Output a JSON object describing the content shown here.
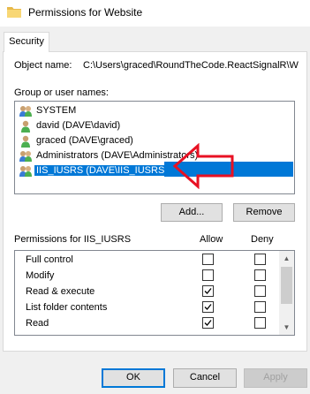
{
  "window": {
    "title": "Permissions for Website"
  },
  "tabs": [
    {
      "label": "Security"
    }
  ],
  "object": {
    "label": "Object name:",
    "value": "C:\\Users\\graced\\RoundTheCode.ReactSignalR\\W"
  },
  "group": {
    "label": "Group or user names:",
    "items": [
      {
        "label": "SYSTEM",
        "icon": "group-users-icon"
      },
      {
        "label": "david (DAVE\\david)",
        "icon": "user-icon"
      },
      {
        "label": "graced (DAVE\\graced)",
        "icon": "user-icon"
      },
      {
        "label": "Administrators (DAVE\\Administrators)",
        "icon": "group-users-icon"
      },
      {
        "label": "IIS_IUSRS (DAVE\\IIS_IUSRS)",
        "icon": "group-users-icon",
        "selected": true
      }
    ]
  },
  "buttons": {
    "add": "Add...",
    "remove": "Remove",
    "ok": "OK",
    "cancel": "Cancel",
    "apply": "Apply"
  },
  "permissions": {
    "label": "Permissions for IIS_IUSRS",
    "allow_header": "Allow",
    "deny_header": "Deny",
    "rows": [
      {
        "name": "Full control",
        "allow": false,
        "deny": false
      },
      {
        "name": "Modify",
        "allow": false,
        "deny": false
      },
      {
        "name": "Read & execute",
        "allow": true,
        "deny": false
      },
      {
        "name": "List folder contents",
        "allow": true,
        "deny": false
      },
      {
        "name": "Read",
        "allow": true,
        "deny": false
      }
    ]
  },
  "colors": {
    "selection": "#0078d7",
    "annotation_arrow": "#e81123",
    "folder": "#e8b94a"
  }
}
